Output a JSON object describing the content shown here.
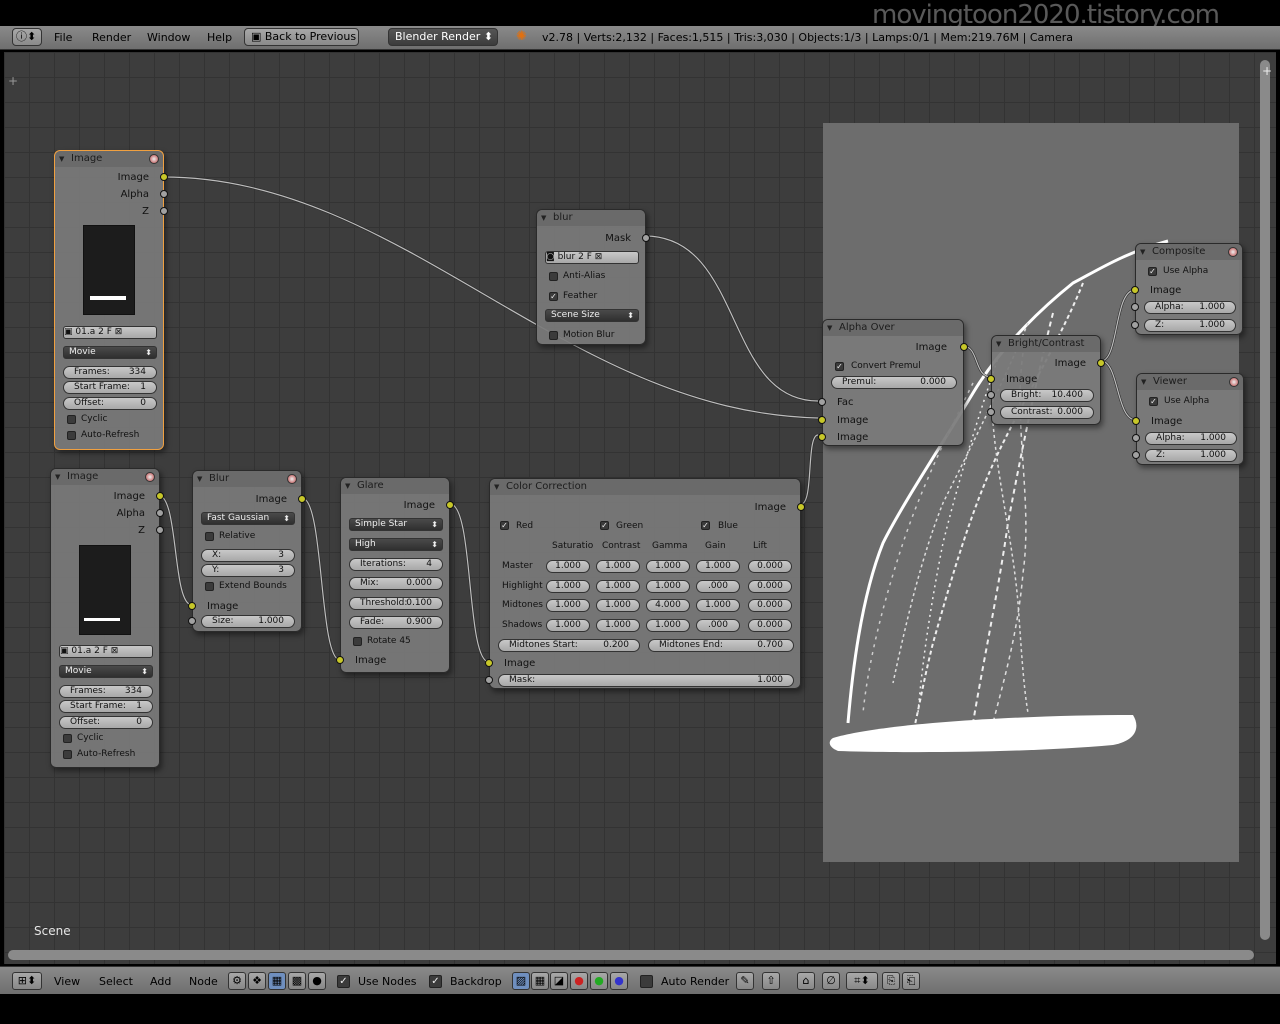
{
  "watermark": "movingtoon2020.tistory.com",
  "topbar": {
    "menus": [
      "File",
      "Render",
      "Window",
      "Help"
    ],
    "back_button": "Back to Previous",
    "render_engine": "Blender Render",
    "stats": "v2.78 | Verts:2,132 | Faces:1,515 | Tris:3,030 | Objects:1/3 | Lamps:0/1 | Mem:219.76M | Camera"
  },
  "editor": {
    "scene_label": "Scene"
  },
  "nodes": {
    "image1": {
      "title": "Image",
      "out_image": "Image",
      "out_alpha": "Alpha",
      "out_z": "Z",
      "file": "01.a",
      "users": "2",
      "fake": "F",
      "source": "Movie",
      "frames_label": "Frames:",
      "frames": "334",
      "start_label": "Start Frame:",
      "start": "1",
      "offset_label": "Offset:",
      "offset": "0",
      "cyclic": "Cyclic",
      "autorefresh": "Auto-Refresh"
    },
    "image2": {
      "title": "Image",
      "out_image": "Image",
      "out_alpha": "Alpha",
      "out_z": "Z",
      "file": "01.a",
      "users": "2",
      "fake": "F",
      "source": "Movie",
      "frames_label": "Frames:",
      "frames": "334",
      "start_label": "Start Frame:",
      "start": "1",
      "offset_label": "Offset:",
      "offset": "0",
      "cyclic": "Cyclic",
      "autorefresh": "Auto-Refresh"
    },
    "blur_mask": {
      "title": "blur",
      "out_mask": "Mask",
      "mask_name": "blur",
      "users": "2",
      "fake": "F",
      "antialias": "Anti-Alias",
      "feather": "Feather",
      "size_mode": "Scene Size",
      "motion_blur": "Motion Blur"
    },
    "blur": {
      "title": "Blur",
      "out_image": "Image",
      "filter": "Fast Gaussian",
      "relative": "Relative",
      "x_label": "X:",
      "x": "3",
      "y_label": "Y:",
      "y": "3",
      "extend": "Extend Bounds",
      "in_image": "Image",
      "size_label": "Size:",
      "size": "1.000"
    },
    "glare": {
      "title": "Glare",
      "out_image": "Image",
      "type": "Simple Star",
      "quality": "High",
      "iter_label": "Iterations:",
      "iter": "4",
      "mix_label": "Mix:",
      "mix": "0.000",
      "thr_label": "Threshold:",
      "thr": "0.100",
      "fade_label": "Fade:",
      "fade": "0.900",
      "rotate": "Rotate 45",
      "in_image": "Image"
    },
    "color_correction": {
      "title": "Color Correction",
      "out_image": "Image",
      "red": "Red",
      "green": "Green",
      "blue": "Blue",
      "cols": [
        "Saturatio",
        "Contrast",
        "Gamma",
        "Gain",
        "Lift"
      ],
      "rows": [
        {
          "label": "Master",
          "vals": [
            "1.000",
            "1.000",
            "1.000",
            "1.000",
            "0.000"
          ]
        },
        {
          "label": "Highlight",
          "vals": [
            "1.000",
            "1.000",
            "1.000",
            ".000",
            "0.000"
          ]
        },
        {
          "label": "Midtones",
          "vals": [
            "1.000",
            "1.000",
            "4.000",
            "1.000",
            "0.000"
          ]
        },
        {
          "label": "Shadows",
          "vals": [
            "1.000",
            "1.000",
            "1.000",
            ".000",
            "0.000"
          ]
        }
      ],
      "mid_start_label": "Midtones Start:",
      "mid_start": "0.200",
      "mid_end_label": "Midtones End:",
      "mid_end": "0.700",
      "in_image": "Image",
      "mask_label": "Mask:",
      "mask": "1.000"
    },
    "alpha_over": {
      "title": "Alpha Over",
      "out_image": "Image",
      "convert": "Convert Premul",
      "premul_label": "Premul:",
      "premul": "0.000",
      "in_fac": "Fac",
      "in_image1": "Image",
      "in_image2": "Image"
    },
    "bright_contrast": {
      "title": "Bright/Contrast",
      "out_image": "Image",
      "in_image": "Image",
      "bright_label": "Bright:",
      "bright": "10.400",
      "contrast_label": "Contrast:",
      "contrast": "0.000"
    },
    "composite": {
      "title": "Composite",
      "use_alpha": "Use Alpha",
      "in_image": "Image",
      "alpha_label": "Alpha:",
      "alpha": "1.000",
      "z_label": "Z:",
      "z": "1.000"
    },
    "viewer": {
      "title": "Viewer",
      "use_alpha": "Use Alpha",
      "in_image": "Image",
      "alpha_label": "Alpha:",
      "alpha": "1.000",
      "z_label": "Z:",
      "z": "1.000"
    }
  },
  "botbar": {
    "menus": [
      "View",
      "Select",
      "Add",
      "Node"
    ],
    "use_nodes": "Use Nodes",
    "backdrop": "Backdrop",
    "auto_render": "Auto Render"
  }
}
